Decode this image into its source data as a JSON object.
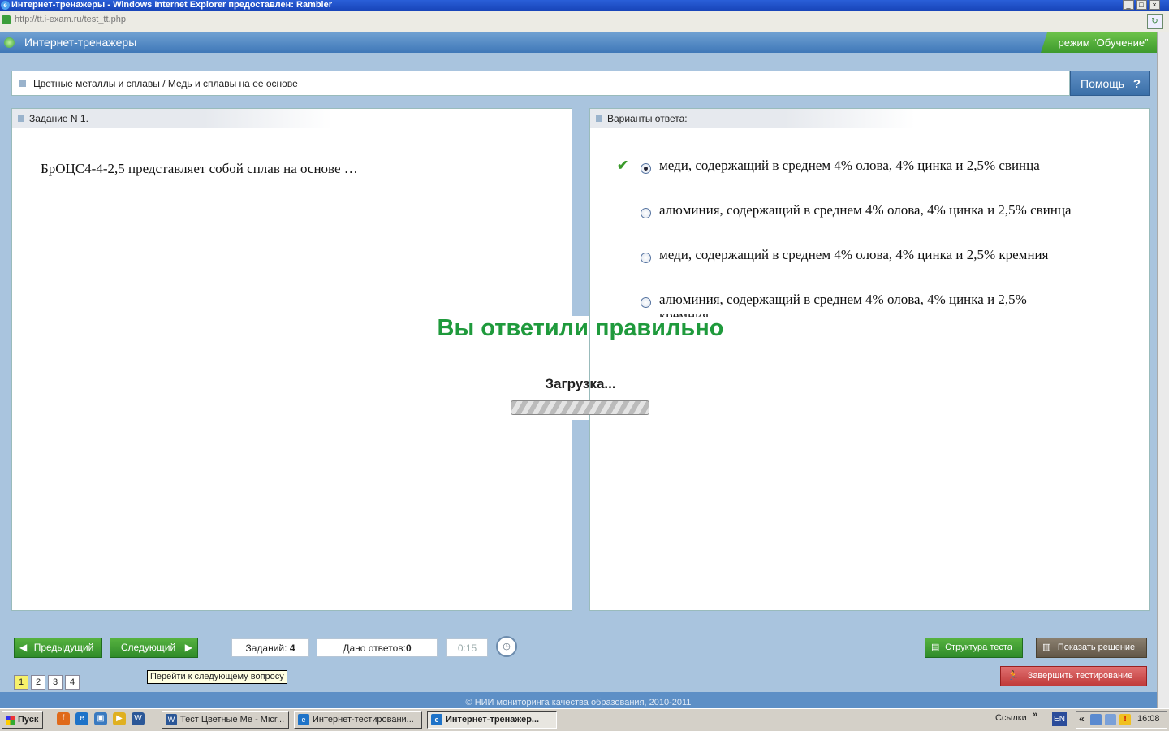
{
  "browser": {
    "title": "Интернет-тренажеры - Windows Internet Explorer предоставлен: Rambler",
    "url": "http://tt.i-exam.ru/test_tt.php"
  },
  "app": {
    "title": "Интернет-тренажеры",
    "mode": "режим “Обучение”",
    "breadcrumb": "Цветные металлы и сплавы / Медь и сплавы на ее основе",
    "help_label": "Помощь",
    "help_icon": "?"
  },
  "question": {
    "header": "Задание N 1.",
    "text": "БрОЦС4-4-2,5 представляет собой сплав на основе …"
  },
  "answers": {
    "header": "Варианты ответа:",
    "options": [
      {
        "text": "меди, содержащий в среднем 4% олова, 4% цинка и 2,5% свинца",
        "selected": true,
        "correct_mark": true
      },
      {
        "text": "алюминия, содержащий в среднем 4% олова, 4% цинка и 2,5% свинца",
        "selected": false,
        "correct_mark": false
      },
      {
        "text": "меди, содержащий в среднем 4% олова, 4% цинка и 2,5% кремния",
        "selected": false,
        "correct_mark": false
      },
      {
        "text": "алюминия, содержащий в среднем 4% олова, 4% цинка и 2,5% кремния",
        "selected": false,
        "correct_mark": false
      }
    ]
  },
  "overlay": {
    "result": "Вы ответили правильно",
    "loading": "Загрузка..."
  },
  "nav": {
    "prev_label": "Предыдущий",
    "next_label": "Следующий",
    "tasks_label": "Заданий:",
    "tasks_value": "4",
    "answered_label": "Дано ответов:",
    "answered_value": "0",
    "timer": "0:15",
    "pages": [
      "1",
      "2",
      "3",
      "4"
    ],
    "current_page": "1",
    "tooltip": "Перейти к следующему вопросу",
    "structure_label": "Структура теста",
    "show_solution_label": "Показать решение",
    "finish_label": "Завершить тестирование"
  },
  "footer": "© НИИ мониторинга качества образования, 2010-2011",
  "taskbar": {
    "start": "Пуск",
    "tasks": [
      {
        "label": "Тест Цветные Ме - Micr...",
        "icon": "W",
        "color": "#2b5797"
      },
      {
        "label": "Интернет-тестировани...",
        "icon": "e",
        "color": "#1e73c8"
      },
      {
        "label": "Интернет-тренажер...",
        "icon": "e",
        "color": "#1e73c8"
      }
    ],
    "links": "Ссылки",
    "lang": "EN",
    "clock": "16:08"
  }
}
